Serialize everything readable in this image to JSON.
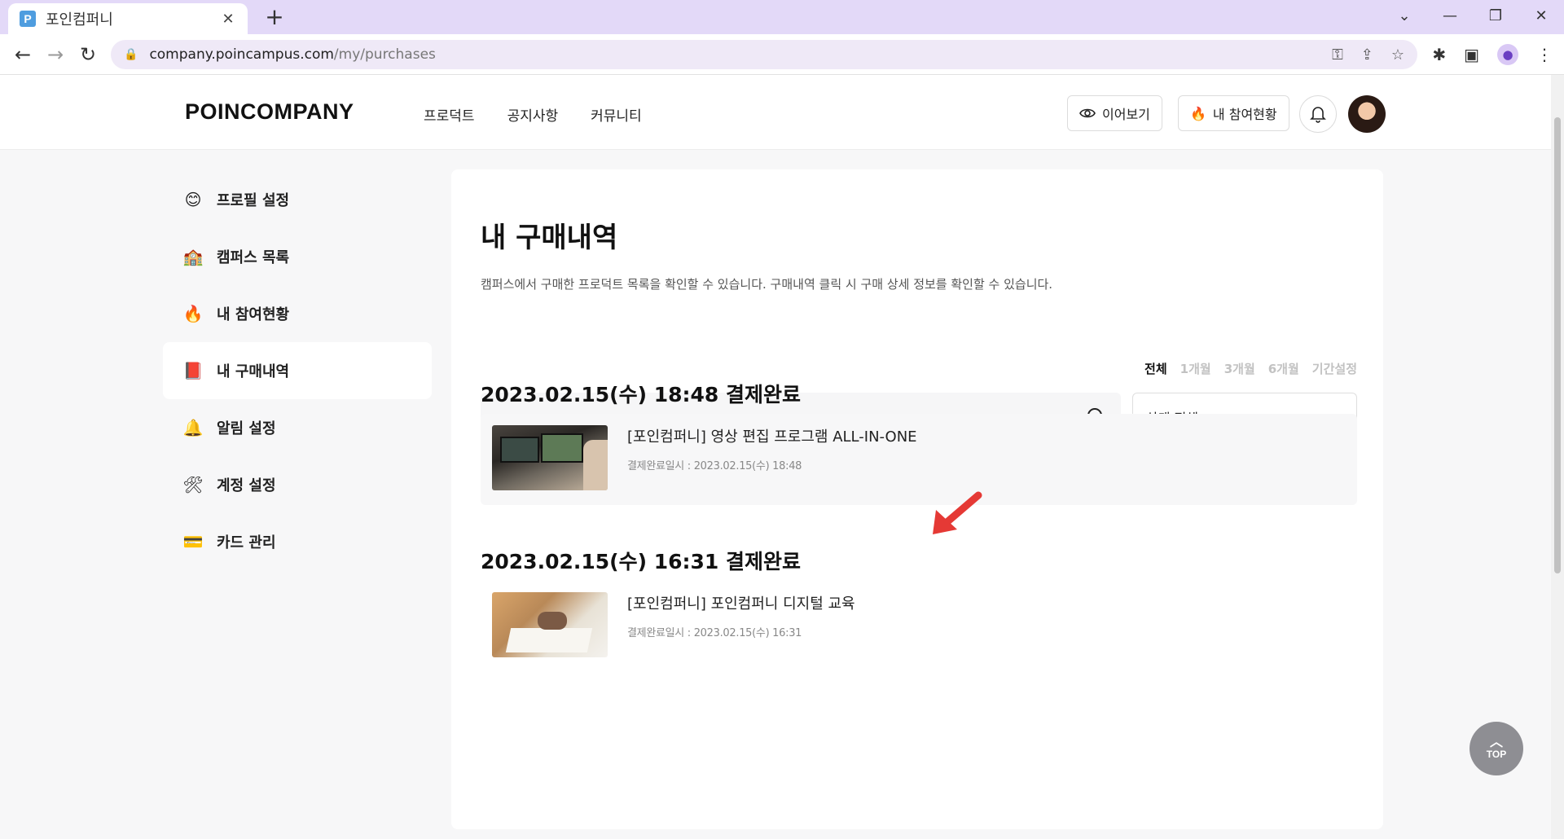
{
  "browser": {
    "tab_title": "포인컴퍼니",
    "tab_favicon": "P",
    "url_host": "company.poincampus.com",
    "url_path": "/my/purchases"
  },
  "header": {
    "logo": "POINCOMPANY",
    "nav": [
      "프로덕트",
      "공지사항",
      "커뮤니티"
    ],
    "continue_label": "이어보기",
    "participation_label": "내 참여현황"
  },
  "sidebar": {
    "items": [
      {
        "label": "프로필 설정",
        "icon": "smile-icon"
      },
      {
        "label": "캠퍼스 목록",
        "icon": "school-icon"
      },
      {
        "label": "내 참여현황",
        "icon": "fire-icon"
      },
      {
        "label": "내 구매내역",
        "icon": "book-icon"
      },
      {
        "label": "알림 설정",
        "icon": "bell-icon"
      },
      {
        "label": "계정 설정",
        "icon": "tools-icon"
      },
      {
        "label": "카드 관리",
        "icon": "card-icon"
      }
    ],
    "active_index": 3
  },
  "main": {
    "title": "내 구매내역",
    "description": "캠퍼스에서 구매한 프로덕트 목록을 확인할 수 있습니다. 구매내역 클릭 시 구매 상세 정보를 확인할 수 있습니다.",
    "period_filters": [
      "전체",
      "1개월",
      "3개월",
      "6개월",
      "기간설정"
    ],
    "period_active": "전체",
    "search": {
      "value": "",
      "placeholder": ""
    },
    "status_select": "상태 전체",
    "orders": [
      {
        "date_status": "2023.02.15(수) 18:48 결제완료",
        "title": "[포인컴퍼니] 영상 편집 프로그램 ALL-IN-ONE",
        "meta": "결제완료일시 : 2023.02.15(수) 18:48"
      },
      {
        "date_status": "2023.02.15(수) 16:31 결제완료",
        "title": "[포인컴퍼니] 포인컴퍼니 디지털 교육",
        "meta": "결제완료일시 : 2023.02.15(수) 16:31"
      }
    ]
  },
  "top_button": "TOP",
  "colors": {
    "tabbar": "#e3d9f8",
    "arrow": "#e53935",
    "top_button": "#8e8e93"
  }
}
